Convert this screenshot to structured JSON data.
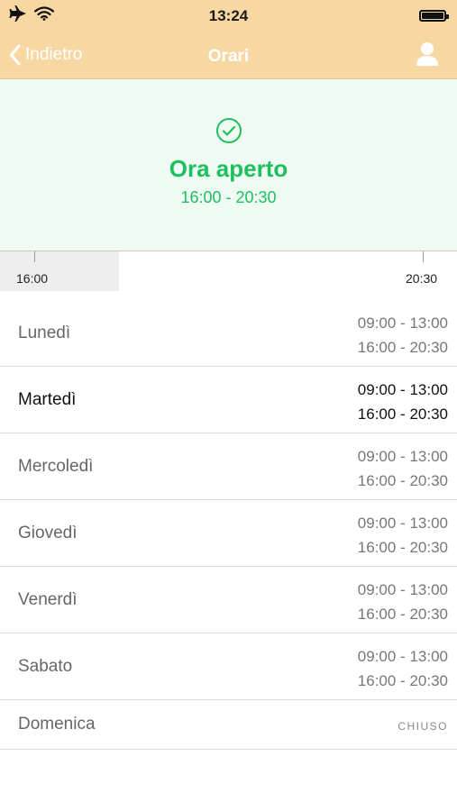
{
  "status_bar": {
    "time": "13:24",
    "icons": [
      "airplane-icon",
      "wifi-icon",
      "battery-icon"
    ]
  },
  "nav": {
    "back_label": "Indietro",
    "title": "Orari",
    "right_icon": "profile-icon"
  },
  "status": {
    "icon": "check-circle-icon",
    "title": "Ora aperto",
    "hours": "16:00 - 20:30",
    "color": "#1fbf5f",
    "background": "#effbf2"
  },
  "timeline": {
    "start_label": "16:00",
    "end_label": "20:30"
  },
  "schedule": [
    {
      "day": "Lunedì",
      "hours": [
        "09:00 - 13:00",
        "16:00 - 20:30"
      ]
    },
    {
      "day": "Martedì",
      "hours": [
        "09:00 - 13:00",
        "16:00 - 20:30"
      ]
    },
    {
      "day": "Mercoledì",
      "hours": [
        "09:00 - 13:00",
        "16:00 - 20:30"
      ]
    },
    {
      "day": "Giovedì",
      "hours": [
        "09:00 - 13:00",
        "16:00 - 20:30"
      ]
    },
    {
      "day": "Venerdì",
      "hours": [
        "09:00 - 13:00",
        "16:00 - 20:30"
      ]
    },
    {
      "day": "Sabato",
      "hours": [
        "09:00 - 13:00",
        "16:00 - 20:30"
      ]
    },
    {
      "day": "Domenica",
      "closed_label": "CHIUSO"
    }
  ],
  "colors": {
    "header_bg": "#f7d8a3",
    "open_green": "#1fbf5f"
  }
}
